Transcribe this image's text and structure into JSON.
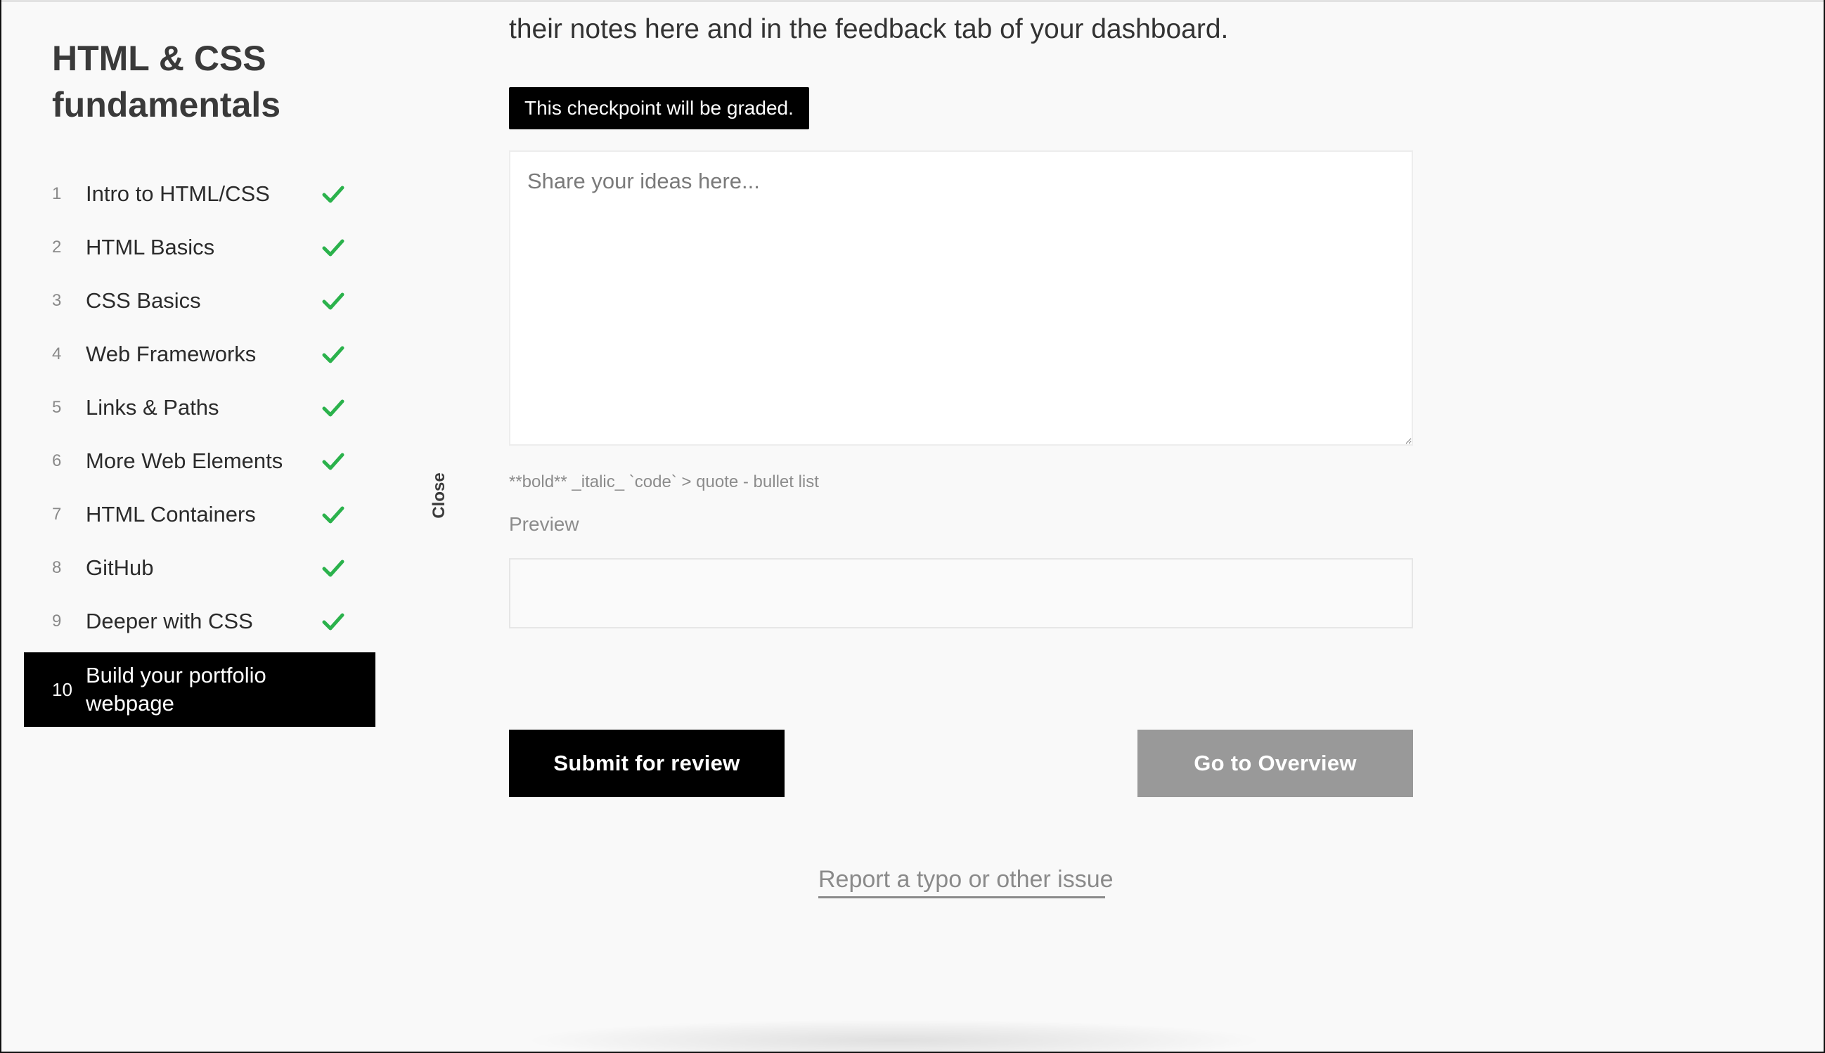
{
  "course": {
    "title": "HTML & CSS fundamentals"
  },
  "lessons": [
    {
      "num": "1",
      "label": "Intro to HTML/CSS",
      "completed": true
    },
    {
      "num": "2",
      "label": "HTML Basics",
      "completed": true
    },
    {
      "num": "3",
      "label": "CSS Basics",
      "completed": true
    },
    {
      "num": "4",
      "label": "Web Frameworks",
      "completed": true
    },
    {
      "num": "5",
      "label": "Links & Paths",
      "completed": true
    },
    {
      "num": "6",
      "label": "More Web Elements",
      "completed": true
    },
    {
      "num": "7",
      "label": "HTML Containers",
      "completed": true
    },
    {
      "num": "8",
      "label": "GitHub",
      "completed": true
    },
    {
      "num": "9",
      "label": "Deeper with CSS",
      "completed": true
    },
    {
      "num": "10",
      "label": "Build your portfolio webpage",
      "completed": false,
      "active": true
    }
  ],
  "sidebar_toggle": {
    "label": "Close"
  },
  "checkpoint": {
    "intro_text": "their notes here and in the feedback tab of your dashboard.",
    "graded_badge": "This checkpoint will be graded.",
    "textarea_placeholder": "Share your ideas here...",
    "textarea_value": "",
    "markdown_hint": "**bold** _italic_ `code` > quote - bullet list",
    "preview_label": "Preview",
    "submit_label": "Submit for review",
    "overview_label": "Go to Overview",
    "report_link": "Report a typo or other issue"
  },
  "colors": {
    "check": "#2bb24c",
    "active_bg": "#000000",
    "secondary_button": "#999999",
    "page_bg": "#f9f9f9"
  },
  "icons": {
    "check": "check-icon"
  }
}
